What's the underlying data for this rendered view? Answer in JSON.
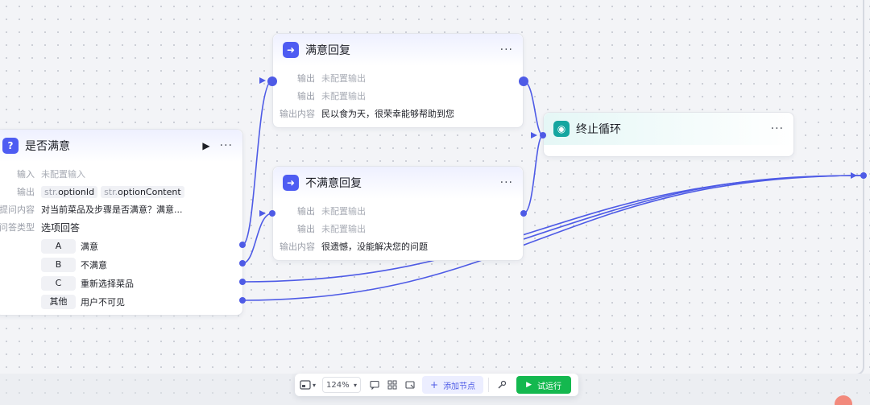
{
  "nodes": {
    "satisfied": {
      "title": "是否满意",
      "input_label": "输入",
      "input_value": "未配置输入",
      "output_label": "输出",
      "output_tags": [
        {
          "prefix": "str.",
          "name": "optionId"
        },
        {
          "prefix": "str.",
          "name": "optionContent"
        }
      ],
      "question_label": "提问内容",
      "question_value": "对当前菜品及步骤是否满意？满意...",
      "qtype_label": "问答类型",
      "qtype_value": "选项回答",
      "options": [
        {
          "key": "A",
          "text": "满意"
        },
        {
          "key": "B",
          "text": "不满意"
        },
        {
          "key": "C",
          "text": "重新选择菜品"
        },
        {
          "key": "其他",
          "text": "用户不可见"
        }
      ]
    },
    "happy_reply": {
      "title": "满意回复",
      "out1_label": "输出",
      "out1_value": "未配置输出",
      "out2_label": "输出",
      "out2_value": "未配置输出",
      "content_label": "输出内容",
      "content_value": "民以食为天，很荣幸能够帮助到您"
    },
    "unhappy_reply": {
      "title": "不满意回复",
      "out1_label": "输出",
      "out1_value": "未配置输出",
      "out2_label": "输出",
      "out2_value": "未配置输出",
      "content_label": "输出内容",
      "content_value": "很遗憾，没能解决您的问题"
    },
    "stop_loop": {
      "title": "终止循环"
    }
  },
  "toolbar": {
    "zoom": "124%",
    "add_node": "添加节点",
    "test_run": "试运行"
  },
  "icons": {
    "question": "question-icon",
    "reply": "reply-arrow-icon",
    "stop": "stop-circle-icon"
  },
  "colors": {
    "accent": "#4e5be6",
    "run": "#14b84f",
    "teal": "#15a6a0"
  }
}
